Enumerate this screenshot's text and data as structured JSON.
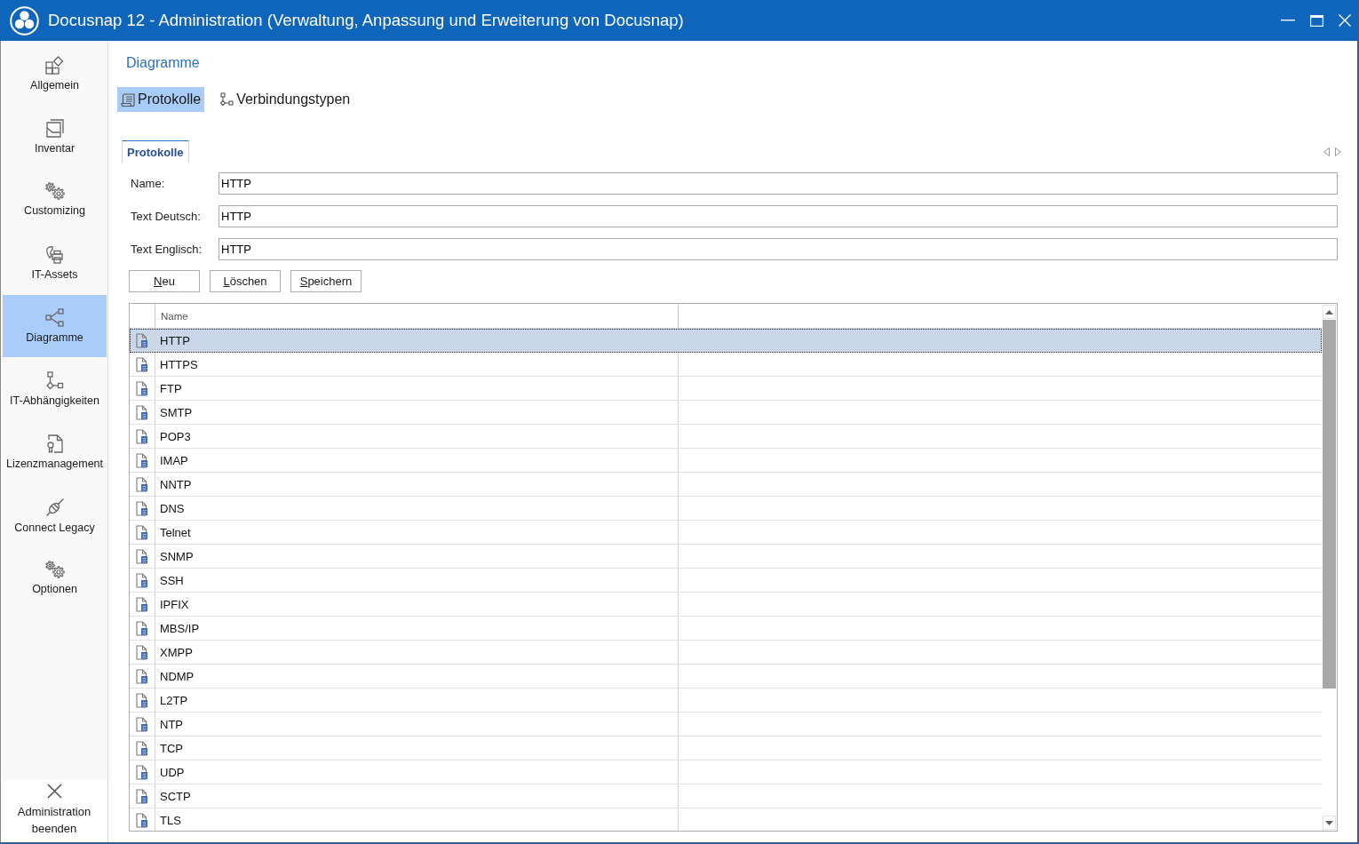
{
  "window": {
    "title": "Docusnap 12 - Administration (Verwaltung, Anpassung und Erweiterung von Docusnap)"
  },
  "sidebar": {
    "items": [
      {
        "label": "Allgemein",
        "selected": false
      },
      {
        "label": "Inventar",
        "selected": false
      },
      {
        "label": "Customizing",
        "selected": false
      },
      {
        "label": "IT-Assets",
        "selected": false
      },
      {
        "label": "Diagramme",
        "selected": true
      },
      {
        "label": "IT-Abhängigkeiten",
        "selected": false
      },
      {
        "label": "Lizenzmanagement",
        "selected": false
      },
      {
        "label": "Connect Legacy",
        "selected": false
      },
      {
        "label": "Optionen",
        "selected": false
      }
    ],
    "exit_button": "Administration beenden"
  },
  "content": {
    "heading": "Diagramme",
    "toolbar": [
      {
        "label": "Protokolle",
        "selected": true
      },
      {
        "label": "Verbindungstypen",
        "selected": false
      }
    ],
    "tabs": [
      {
        "label": "Protokolle",
        "selected": true
      }
    ],
    "form": [
      {
        "label": "Name:",
        "value": "HTTP"
      },
      {
        "label": "Text Deutsch:",
        "value": "HTTP"
      },
      {
        "label": "Text Englisch:",
        "value": "HTTP"
      }
    ],
    "buttons": [
      "Neu",
      "Löschen",
      "Speichern"
    ],
    "table": {
      "columns": [
        "Name"
      ],
      "rows": [
        {
          "name": "HTTP",
          "selected": true
        },
        {
          "name": "HTTPS",
          "selected": false
        },
        {
          "name": "FTP",
          "selected": false
        },
        {
          "name": "SMTP",
          "selected": false
        },
        {
          "name": "POP3",
          "selected": false
        },
        {
          "name": "IMAP",
          "selected": false
        },
        {
          "name": "NNTP",
          "selected": false
        },
        {
          "name": "DNS",
          "selected": false
        },
        {
          "name": "Telnet",
          "selected": false
        },
        {
          "name": "SNMP",
          "selected": false
        },
        {
          "name": "SSH",
          "selected": false
        },
        {
          "name": "IPFIX",
          "selected": false
        },
        {
          "name": "MBS/IP",
          "selected": false
        },
        {
          "name": "XMPP",
          "selected": false
        },
        {
          "name": "NDMP",
          "selected": false
        },
        {
          "name": "L2TP",
          "selected": false
        },
        {
          "name": "NTP",
          "selected": false
        },
        {
          "name": "TCP",
          "selected": false
        },
        {
          "name": "UDP",
          "selected": false
        },
        {
          "name": "SCTP",
          "selected": false
        },
        {
          "name": "TLS",
          "selected": false
        }
      ]
    }
  }
}
